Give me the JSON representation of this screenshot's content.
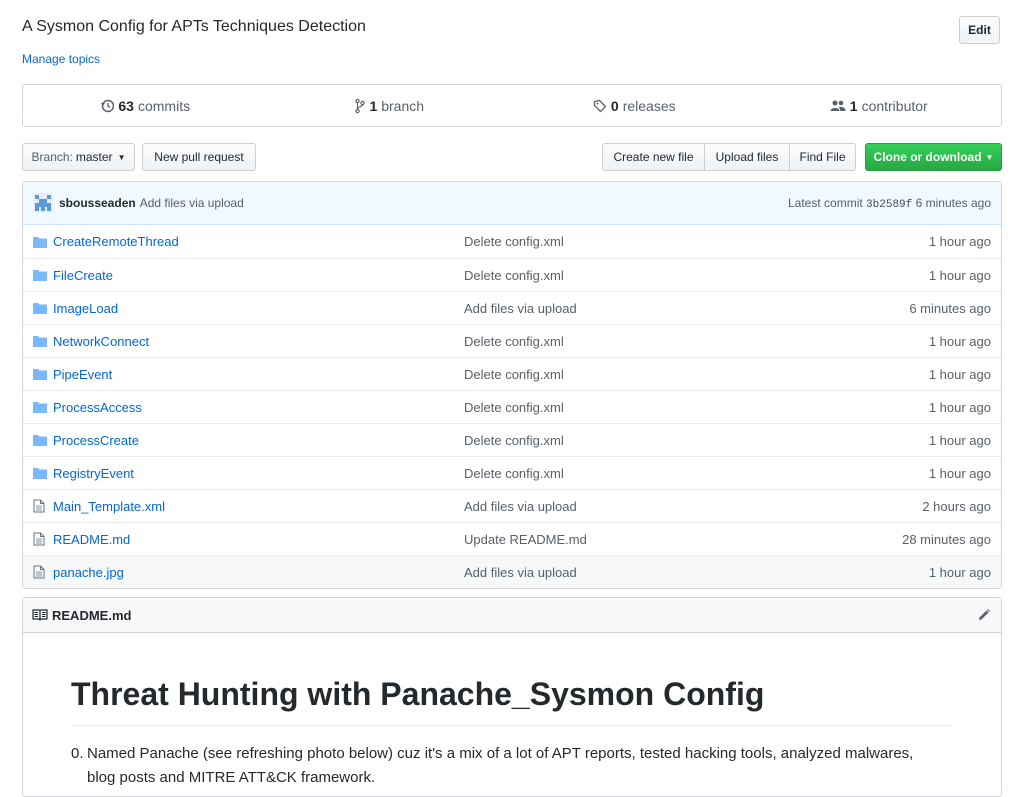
{
  "repo": {
    "description": "A Sysmon Config for APTs Techniques Detection",
    "manage_topics": "Manage topics",
    "edit_label": "Edit"
  },
  "summary": {
    "commits_count": "63",
    "commits_label": "commits",
    "branch_count": "1",
    "branch_label": "branch",
    "releases_count": "0",
    "releases_label": "releases",
    "contributor_count": "1",
    "contributor_label": "contributor"
  },
  "toolbar": {
    "branch_prefix": "Branch:",
    "branch_name": "master",
    "new_pr": "New pull request",
    "create_file": "Create new file",
    "upload_files": "Upload files",
    "find_file": "Find File",
    "clone": "Clone or download"
  },
  "commit": {
    "author": "sbousseaden",
    "message": "Add files via upload",
    "latest_label": "Latest commit",
    "sha": "3b2589f",
    "age": "6 minutes ago"
  },
  "files": [
    {
      "type": "folder",
      "name": "CreateRemoteThread",
      "message": "Delete config.xml",
      "age": "1 hour ago"
    },
    {
      "type": "folder",
      "name": "FileCreate",
      "message": "Delete config.xml",
      "age": "1 hour ago"
    },
    {
      "type": "folder",
      "name": "ImageLoad",
      "message": "Add files via upload",
      "age": "6 minutes ago"
    },
    {
      "type": "folder",
      "name": "NetworkConnect",
      "message": "Delete config.xml",
      "age": "1 hour ago"
    },
    {
      "type": "folder",
      "name": "PipeEvent",
      "message": "Delete config.xml",
      "age": "1 hour ago"
    },
    {
      "type": "folder",
      "name": "ProcessAccess",
      "message": "Delete config.xml",
      "age": "1 hour ago"
    },
    {
      "type": "folder",
      "name": "ProcessCreate",
      "message": "Delete config.xml",
      "age": "1 hour ago"
    },
    {
      "type": "folder",
      "name": "RegistryEvent",
      "message": "Delete config.xml",
      "age": "1 hour ago"
    },
    {
      "type": "file",
      "name": "Main_Template.xml",
      "message": "Add files via upload",
      "age": "2 hours ago"
    },
    {
      "type": "file",
      "name": "README.md",
      "message": "Update README.md",
      "age": "28 minutes ago"
    },
    {
      "type": "file",
      "name": "panache.jpg",
      "message": "Add files via upload",
      "age": "1 hour ago"
    }
  ],
  "readme": {
    "filename": "README.md",
    "heading": "Threat Hunting with Panache_Sysmon Config",
    "item_number": "0.",
    "item_text": "Named Panache (see refreshing photo below) cuz it's a mix of a lot of APT reports, tested hacking tools, analyzed malwares, blog posts and MITRE ATT&CK framework."
  },
  "colors": {
    "link": "#0366d6",
    "green": "#28a745",
    "commit_bar": "#f1f8ff",
    "folder_icon": "#79b8ff"
  },
  "icons": {
    "commits": "history-icon",
    "branch": "git-branch-icon",
    "releases": "tag-icon",
    "contributors": "people-icon",
    "folder": "folder-icon",
    "file": "file-icon",
    "readme": "book-icon",
    "edit": "pencil-icon"
  }
}
